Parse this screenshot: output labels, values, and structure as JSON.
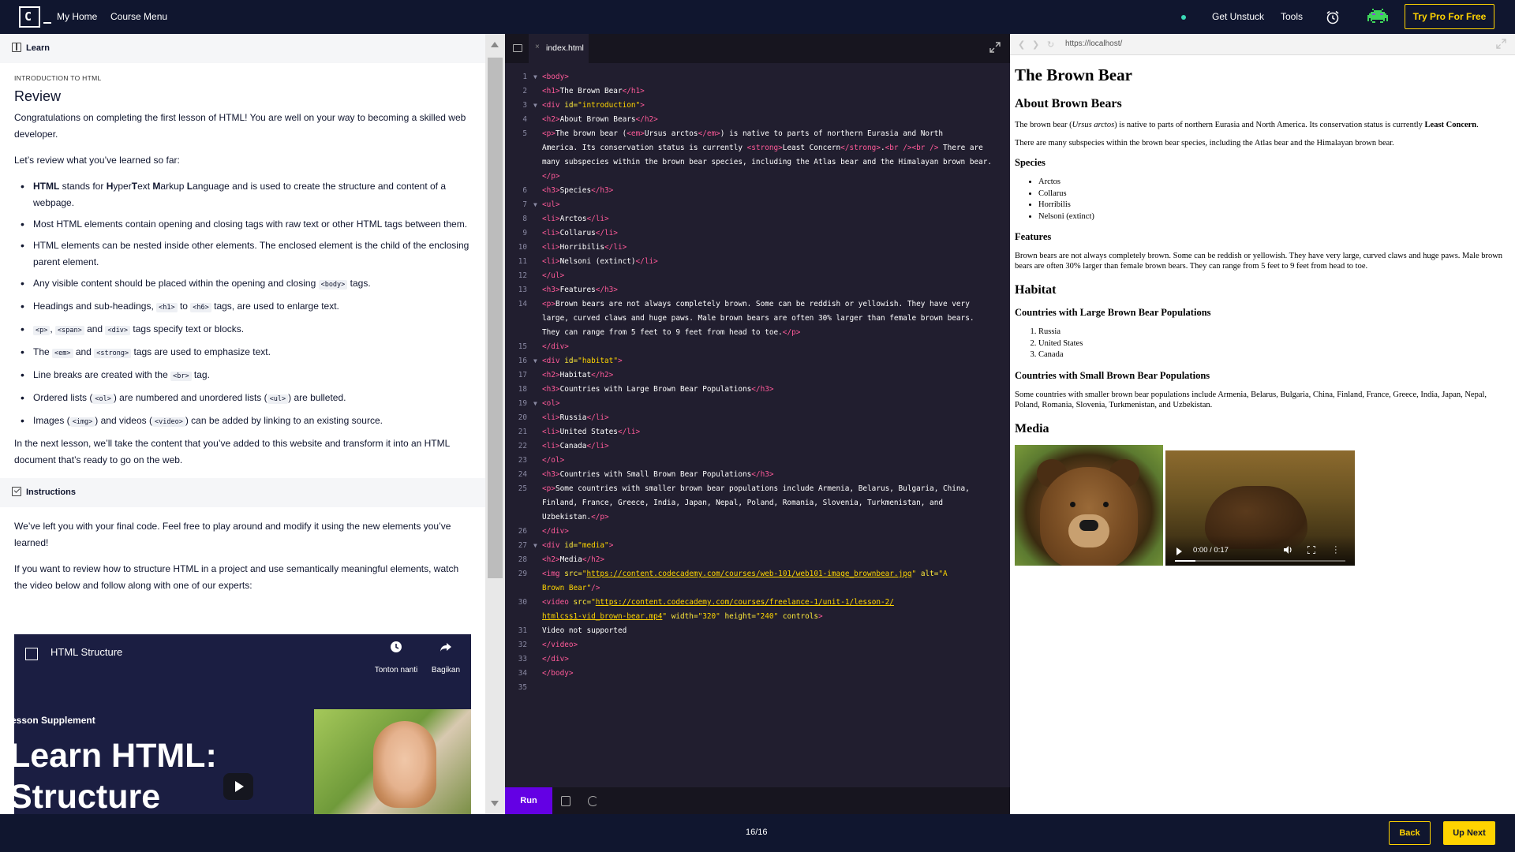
{
  "nav": {
    "logo_text": "C",
    "my_home": "My Home",
    "course_menu": "Course Menu",
    "get_unstuck": "Get Unstuck",
    "tools": "Tools",
    "try_pro": "Try Pro For Free",
    "status_dot_color": "#3ad9b6",
    "icons": [
      "alarm-clock-icon",
      "avatar-space-invader"
    ]
  },
  "learn": {
    "header": "Learn",
    "kicker": "INTRODUCTION TO HTML",
    "title": "Review",
    "intro": "Congratulations on completing the first lesson of HTML! You are well on your way to becoming a skilled web developer.",
    "lead": "Let’s review what you’ve learned so far:",
    "bullets": [
      {
        "pre": "",
        "bold": "HTML",
        "post": " stands for HyperText Markup Language and is used to create the structure and content of a webpage."
      },
      {
        "pre": "Most HTML elements contain opening and closing tags with raw text or other HTML tags between them.",
        "bold": "",
        "post": ""
      },
      {
        "pre": "HTML elements can be nested inside other elements. The enclosed element is the child of the enclosing parent element.",
        "bold": "",
        "post": ""
      },
      {
        "pre": "Any visible content should be placed within the opening and closing ",
        "code": "<body>",
        "post": " tags."
      },
      {
        "pre": "Headings and sub-headings, ",
        "code": "<h1>",
        "mid": " to ",
        "code2": "<h6>",
        "post": " tags, are used to enlarge text."
      },
      {
        "pre": "",
        "code": "<p>",
        "mid": ", ",
        "code2": "<span>",
        "mid2": " and ",
        "code3": "<div>",
        "post": " tags specify text or blocks."
      },
      {
        "pre": "The ",
        "code": "<em>",
        "mid": " and ",
        "code2": "<strong>",
        "post": " tags are used to emphasize text."
      },
      {
        "pre": "Line breaks are created with the ",
        "code": "<br>",
        "post": " tag."
      },
      {
        "pre": "Ordered lists (",
        "code": "<ol>",
        "mid": ") are numbered and unordered lists (",
        "code2": "<ul>",
        "post": ") are bulleted."
      },
      {
        "pre": "Images (",
        "code": "<img>",
        "mid": ") and videos (",
        "code2": "<video>",
        "post": ") can be added by linking to an existing source."
      }
    ],
    "outro": "In the next lesson, we’ll take the content that you’ve added to this website and transform it into an HTML document that’s ready to go on the web."
  },
  "instructions": {
    "header": "Instructions",
    "p1": "We’ve left you with your final code. Feel free to play around and modify it using the new elements you’ve learned!",
    "p2": "If you want to review how to structure HTML in a project and use semantically meaningful elements, watch the video below and follow along with one of our experts:",
    "video": {
      "title": "HTML Structure",
      "watch_later": "Tonton nanti",
      "share": "Bagikan",
      "supplement": "esson Supplement",
      "headline_1": "Learn HTML:",
      "headline_2": "Structure"
    }
  },
  "editor": {
    "tab": "index.html",
    "run": "Run"
  },
  "browser": {
    "url": "https://localhost/",
    "h1": "The Brown Bear",
    "about_h2": "About Brown Bears",
    "about_p1_a": "The brown bear (",
    "about_p1_em": "Ursus arctos",
    "about_p1_b": ") is native to parts of northern Eurasia and North America. Its conservation status is currently ",
    "about_p1_strong": "Least Concern",
    "about_p1_c": ".",
    "about_p2": "There are many subspecies within the brown bear species, including the Atlas bear and the Himalayan brown bear.",
    "species_h3": "Species",
    "species": [
      "Arctos",
      "Collarus",
      "Horribilis",
      "Nelsoni (extinct)"
    ],
    "features_h3": "Features",
    "features_p": "Brown bears are not always completely brown. Some can be reddish or yellowish. They have very large, curved claws and huge paws. Male brown bears are often 30% larger than female brown bears. They can range from 5 feet to 9 feet from head to toe.",
    "habitat_h2": "Habitat",
    "large_h3": "Countries with Large Brown Bear Populations",
    "large": [
      "Russia",
      "United States",
      "Canada"
    ],
    "small_h3": "Countries with Small Brown Bear Populations",
    "small_p": "Some countries with smaller brown bear populations include Armenia, Belarus, Bulgaria, China, Finland, France, Greece, India, Japan, Nepal, Poland, Romania, Slovenia, Turkmenistan, and Uzbekistan.",
    "media_h2": "Media",
    "video_time": "0:00 / 0:17",
    "video_progress": 0.12
  },
  "footer": {
    "progress": "16/16",
    "back": "Back",
    "next": "Up Next"
  }
}
